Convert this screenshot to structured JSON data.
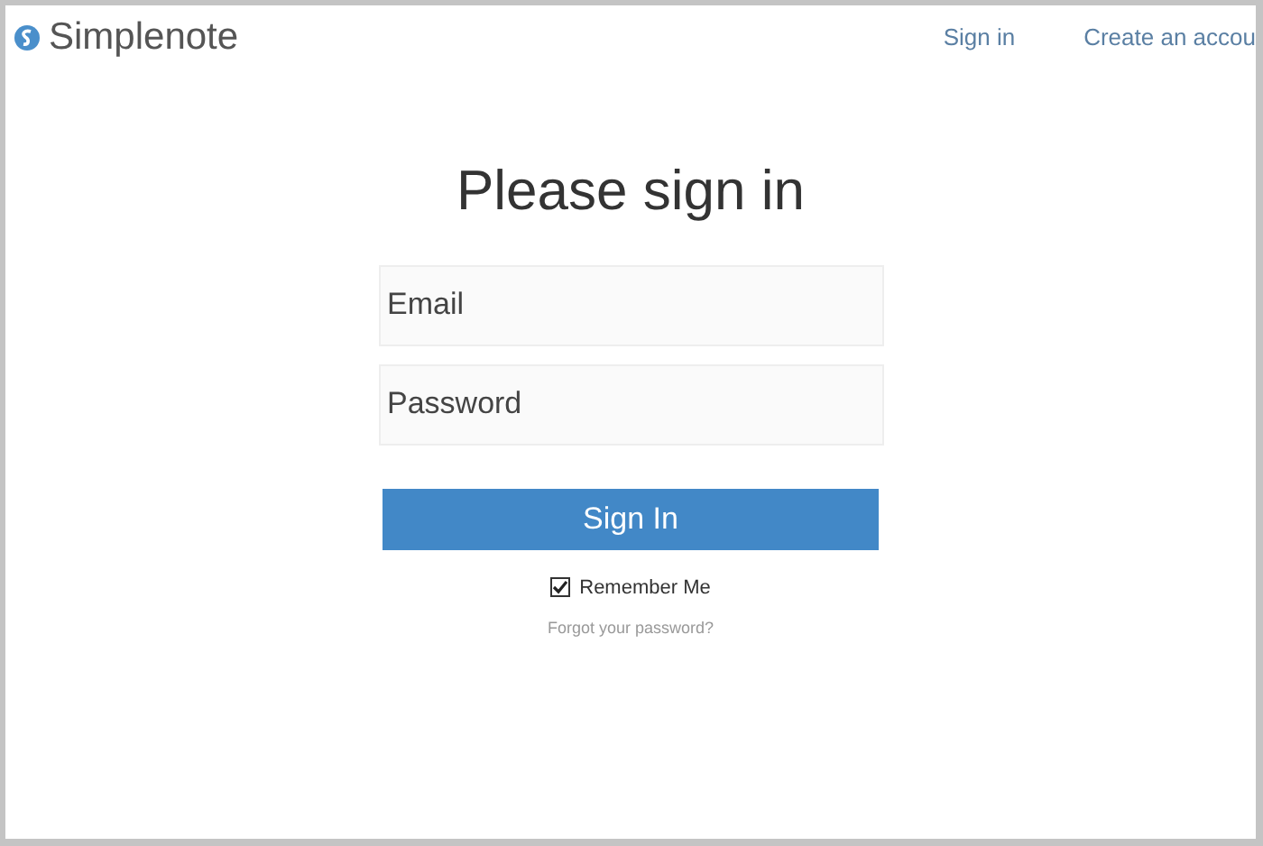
{
  "header": {
    "logo": "Simplenote",
    "nav": [
      {
        "label": "Sign in"
      },
      {
        "label": "Create an accou"
      }
    ]
  },
  "title": "Please sign in",
  "fields": [
    {
      "placeholder": "Email"
    },
    {
      "placeholder": "Password"
    }
  ],
  "submit": "Sign In",
  "remember": {
    "label": "Remember Me",
    "checked": true
  },
  "forgot": "Forgot your password?"
}
